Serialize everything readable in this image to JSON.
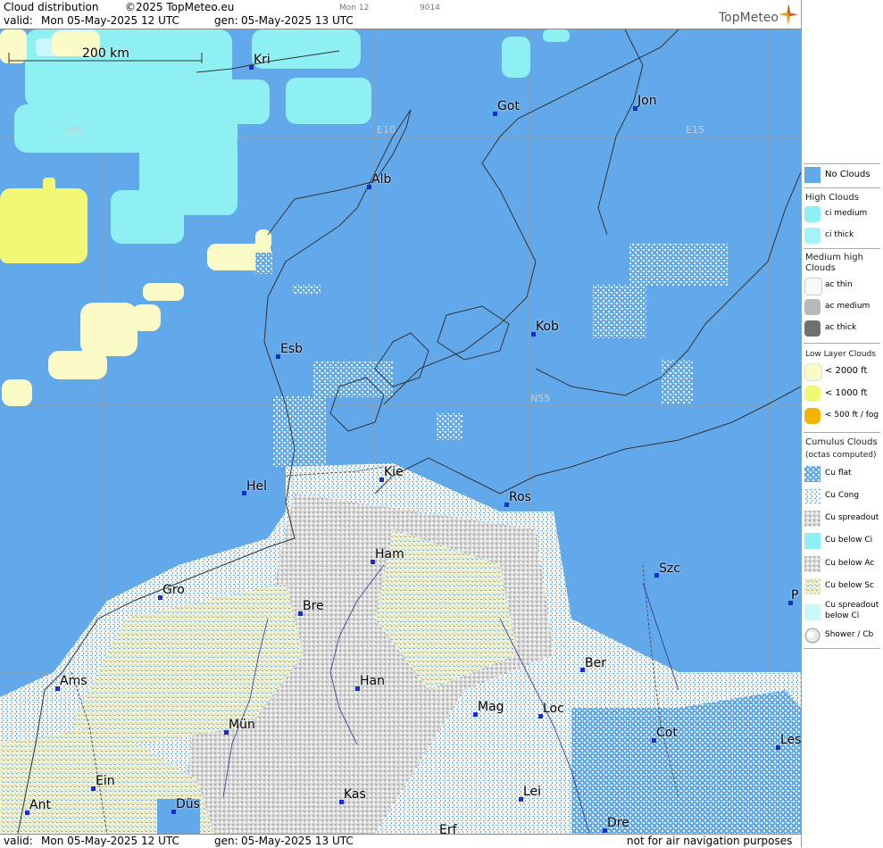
{
  "header": {
    "title": "Cloud distribution",
    "copyright": "©2025 TopMeteo.eu",
    "valid_label": "valid:",
    "valid_value": "Mon  05-May-2025  12 UTC",
    "gen_label": "gen:",
    "gen_value": "05-May-2025 13 UTC",
    "small1": "Mon 12",
    "small2": "9014",
    "brand": "TopMeteo"
  },
  "footer": {
    "valid_label": "valid:",
    "valid_value": "Mon  05-May-2025  12 UTC",
    "gen_label": "gen:",
    "gen_value": "05-May-2025 13 UTC",
    "disclaimer": "not for air navigation purposes"
  },
  "scale": {
    "label": "200 km"
  },
  "grid_labels": {
    "e05": "E05",
    "e10": "E10",
    "e15": "E15",
    "n55": "N55"
  },
  "cities": {
    "kri": "Kri",
    "got": "Got",
    "jon": "Jon",
    "alb": "Alb",
    "kob": "Kob",
    "esb": "Esb",
    "kie": "Kie",
    "hel": "Hel",
    "ros": "Ros",
    "ham": "Ham",
    "szc": "Szc",
    "p": "P",
    "gro": "Gro",
    "bre": "Bre",
    "ber": "Ber",
    "ams": "Ams",
    "han": "Han",
    "mag": "Mag",
    "loc": "Loc",
    "mun": "Mün",
    "cot": "Cot",
    "les": "Les",
    "ein": "Ein",
    "lei": "Lei",
    "kas": "Kas",
    "ant": "Ant",
    "dus": "Düs",
    "dre": "Dre",
    "erf": "Erf"
  },
  "legend": {
    "no_clouds": "No Clouds",
    "high_head": "High Clouds",
    "ci_medium": "ci medium",
    "ci_thick": "ci thick",
    "medium_head": "Medium high Clouds",
    "ac_thin": "ac thin",
    "ac_medium": "ac medium",
    "ac_thick": "ac thick",
    "low_head": "Low Layer Clouds",
    "lt2000": "< 2000 ft",
    "lt1000": "< 1000 ft",
    "lt500": "< 500 ft / fog",
    "cu_head": "Cumulus Clouds",
    "cu_sub": "(octas computed)",
    "cu_flat": "Cu flat",
    "cu_cong": "Cu Cong",
    "cu_spread": "Cu spreadout",
    "cu_below_ci": "Cu below Ci",
    "cu_below_ac": "Cu below Ac",
    "cu_below_sc": "Cu below Sc",
    "cu_spread_ci_1": "Cu spreadout",
    "cu_spread_ci_2": "below Ci",
    "shower": "Shower / Cb"
  },
  "colors": {
    "no_clouds": "#62a9ec",
    "ci_medium": "#8ff0f4",
    "ac_thin": "#f8f8f8",
    "ac_medium": "#b8b8b8",
    "ac_thick": "#707070",
    "lt2000": "#fbfbc8",
    "lt1000": "#f3f776",
    "lt500": "#f2b400",
    "city_dot": "#1a2bd1"
  }
}
